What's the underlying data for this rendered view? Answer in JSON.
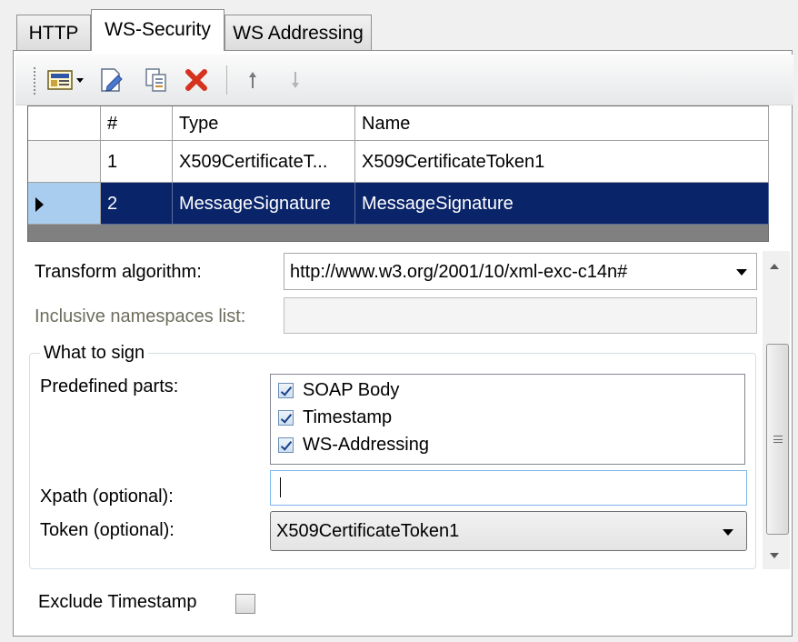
{
  "tabs": [
    {
      "label": "HTTP"
    },
    {
      "label": "WS-Security"
    },
    {
      "label": "WS Addressing"
    }
  ],
  "toolbar": {
    "icons": [
      "add-dropdown-icon",
      "edit-icon",
      "copy-icon",
      "delete-icon",
      "move-up-icon",
      "move-down-icon"
    ]
  },
  "grid": {
    "columns": [
      "#",
      "Type",
      "Name"
    ],
    "rows": [
      {
        "num": "1",
        "type": "X509CertificateT...",
        "name": "X509CertificateToken1"
      },
      {
        "num": "2",
        "type": "MessageSignature",
        "name": "MessageSignature"
      }
    ],
    "selected_row": 2
  },
  "form": {
    "transform_label": "Transform algorithm:",
    "transform_value": "http://www.w3.org/2001/10/xml-exc-c14n#",
    "inclusive_label": "Inclusive namespaces list:",
    "inclusive_value": "",
    "group_label": "What to sign",
    "predefined_label": "Predefined parts:",
    "parts": [
      {
        "label": "SOAP Body",
        "checked": true
      },
      {
        "label": "Timestamp",
        "checked": true
      },
      {
        "label": "WS-Addressing",
        "checked": true
      }
    ],
    "xpath_label": "Xpath (optional):",
    "xpath_value": "",
    "token_label": "Token (optional):",
    "token_value": "X509CertificateToken1",
    "exclude_label": "Exclude Timestamp",
    "exclude_checked": false
  },
  "colors": {
    "selection": "#0a246a",
    "delete_icon": "#d6331f",
    "focus_border": "#7eb4ea"
  }
}
